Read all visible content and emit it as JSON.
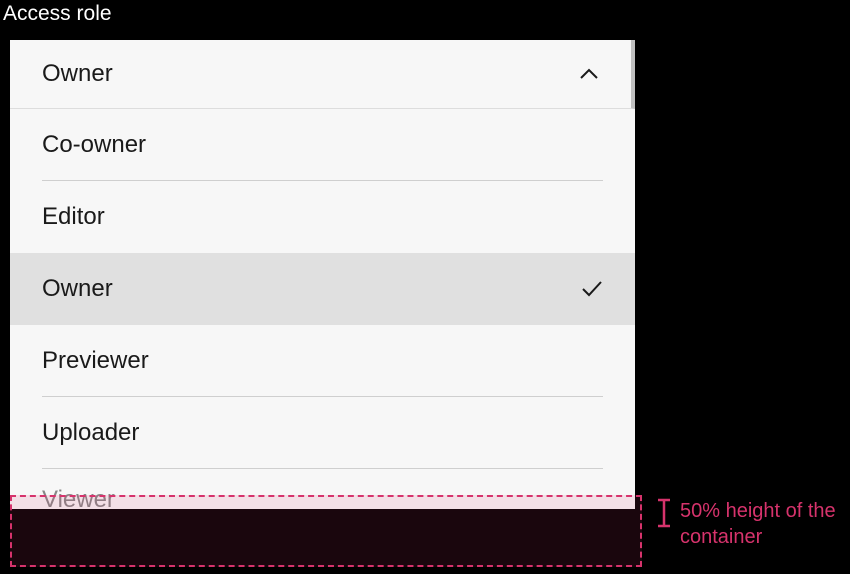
{
  "label": "Access role",
  "dropdown": {
    "selected": "Owner",
    "options": [
      {
        "label": "Co-owner",
        "selected": false
      },
      {
        "label": "Editor",
        "selected": false
      },
      {
        "label": "Owner",
        "selected": true
      },
      {
        "label": "Previewer",
        "selected": false
      },
      {
        "label": "Uploader",
        "selected": false
      },
      {
        "label": "Viewer",
        "selected": false
      }
    ]
  },
  "annotation": {
    "text": "50% height of the container"
  }
}
